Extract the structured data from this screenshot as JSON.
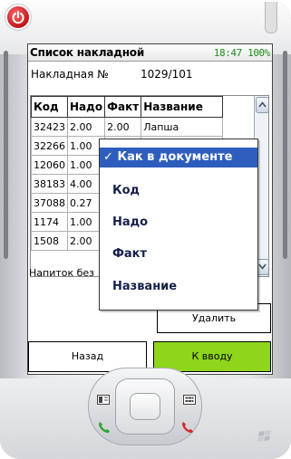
{
  "titlebar": {
    "title": "Список накладной",
    "status": "18:47 100%"
  },
  "invoice": {
    "label": "Накладная №",
    "number": "1029/101"
  },
  "table": {
    "headers": [
      "Код",
      "Надо",
      "Факт",
      "Название"
    ],
    "rows": [
      [
        "32423",
        "2.00",
        "2.00",
        "Лапша"
      ],
      [
        "32266",
        "1.00",
        "",
        ""
      ],
      [
        "12060",
        "1.00",
        "",
        ""
      ],
      [
        "38183",
        "4.00",
        "",
        ""
      ],
      [
        "37088",
        "0.27",
        "",
        ""
      ],
      [
        "1174",
        "1.00",
        "",
        ""
      ],
      [
        "1508",
        "2.00",
        "",
        ""
      ]
    ]
  },
  "drink_text": "Напиток без",
  "buttons": {
    "delete": "Удалить",
    "back": "Назад",
    "go": "К вводу"
  },
  "context_menu": {
    "items": [
      {
        "label": "Как в документе",
        "checked": true
      },
      {
        "label": "Код",
        "checked": false
      },
      {
        "label": "Надо",
        "checked": false
      },
      {
        "label": "Факт",
        "checked": false
      },
      {
        "label": "Название",
        "checked": false
      }
    ],
    "checkmark": "✓"
  },
  "colors": {
    "accent_green": "#8fd51b",
    "menu_selection": "#2e5ebd",
    "status_green": "#1b8a1b"
  }
}
